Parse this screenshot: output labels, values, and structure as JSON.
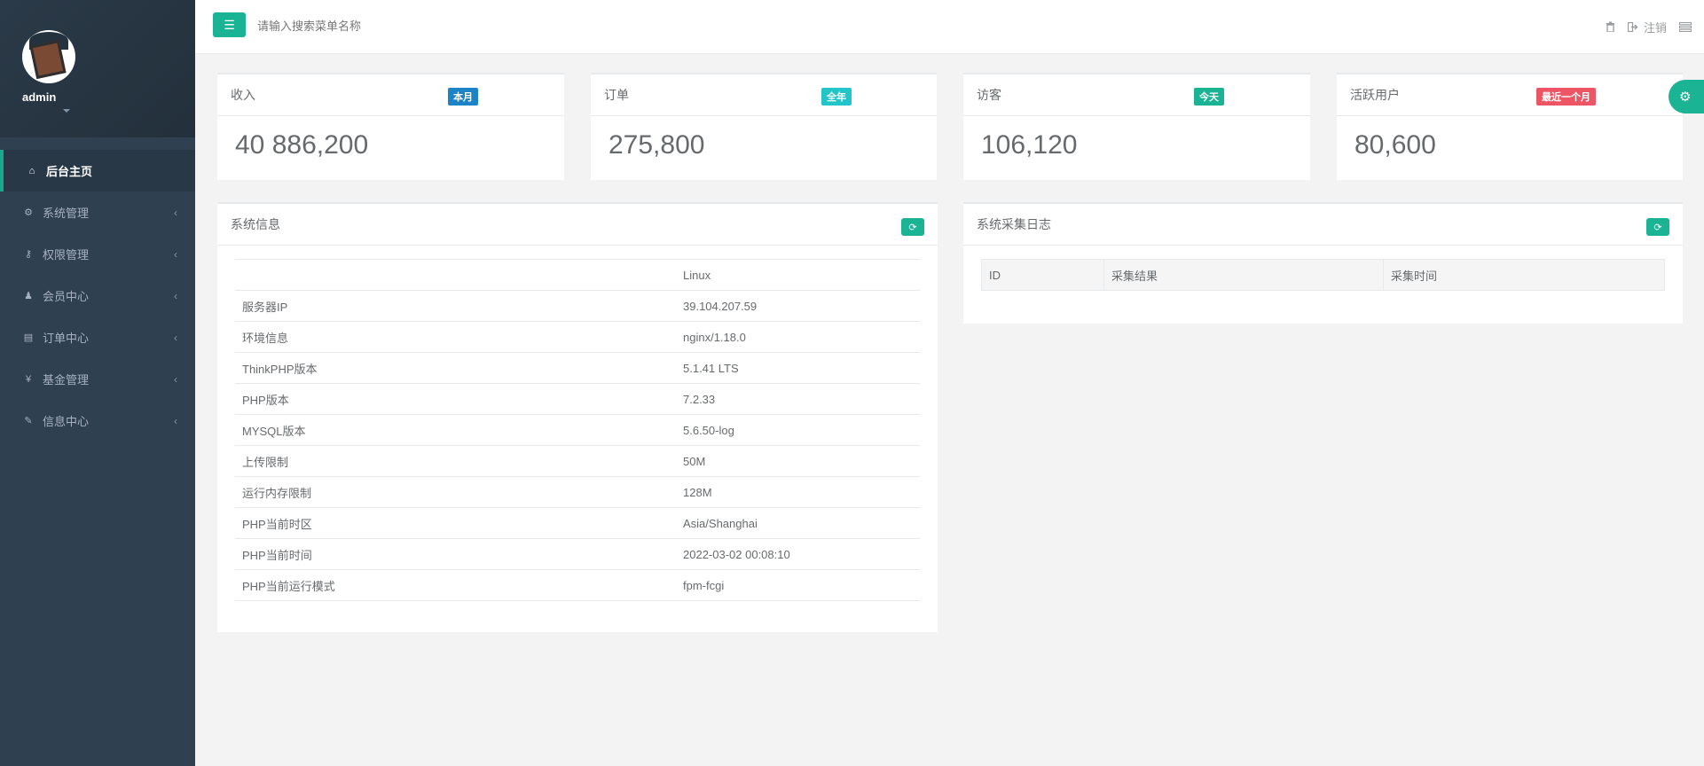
{
  "user": {
    "name": "admin"
  },
  "nav": [
    {
      "label": "后台主页",
      "icon": "home-icon",
      "glyph": "⌂",
      "active": true,
      "arrow": ""
    },
    {
      "label": "系统管理",
      "icon": "cogs-icon",
      "glyph": "⚙",
      "active": false,
      "arrow": "‹"
    },
    {
      "label": "权限管理",
      "icon": "key-icon",
      "glyph": "⚷",
      "active": false,
      "arrow": "‹"
    },
    {
      "label": "会员中心",
      "icon": "user-icon",
      "glyph": "♟",
      "active": false,
      "arrow": "‹"
    },
    {
      "label": "订单中心",
      "icon": "list-icon",
      "glyph": "▤",
      "active": false,
      "arrow": "‹"
    },
    {
      "label": "基金管理",
      "icon": "yen-icon",
      "glyph": "¥",
      "active": false,
      "arrow": "‹"
    },
    {
      "label": "信息中心",
      "icon": "wrench-icon",
      "glyph": "✎",
      "active": false,
      "arrow": "‹"
    }
  ],
  "topbar": {
    "search_placeholder": "请输入搜索菜单名称",
    "logout_label": "注销"
  },
  "stats": [
    {
      "title": "收入",
      "badge": "本月",
      "badge_color": "#1c84c6",
      "value": "40 886,200"
    },
    {
      "title": "订单",
      "badge": "全年",
      "badge_color": "#23c6c8",
      "value": "275,800"
    },
    {
      "title": "访客",
      "badge": "今天",
      "badge_color": "#1ab394",
      "value": "106,120"
    },
    {
      "title": "活跃用户",
      "badge": "最近一个月",
      "badge_color": "#ed5565",
      "value": "80,600"
    }
  ],
  "system_info": {
    "title": "系统信息",
    "rows": [
      {
        "label": "",
        "value": "Linux"
      },
      {
        "label": "服务器IP",
        "value": "39.104.207.59"
      },
      {
        "label": "环境信息",
        "value": "nginx/1.18.0"
      },
      {
        "label": "ThinkPHP版本",
        "value": "5.1.41 LTS"
      },
      {
        "label": "PHP版本",
        "value": "7.2.33"
      },
      {
        "label": "MYSQL版本",
        "value": "5.6.50-log"
      },
      {
        "label": "上传限制",
        "value": "50M"
      },
      {
        "label": "运行内存限制",
        "value": "128M"
      },
      {
        "label": "PHP当前时区",
        "value": "Asia/Shanghai"
      },
      {
        "label": "PHP当前时间",
        "value": "2022-03-02 00:08:10"
      },
      {
        "label": "PHP当前运行模式",
        "value": "fpm-fcgi"
      }
    ]
  },
  "collect_log": {
    "title": "系统采集日志",
    "columns": [
      "ID",
      "采集结果",
      "采集时间"
    ]
  },
  "colors": {
    "accent": "#1ab394",
    "sidebar": "#2f4050"
  }
}
